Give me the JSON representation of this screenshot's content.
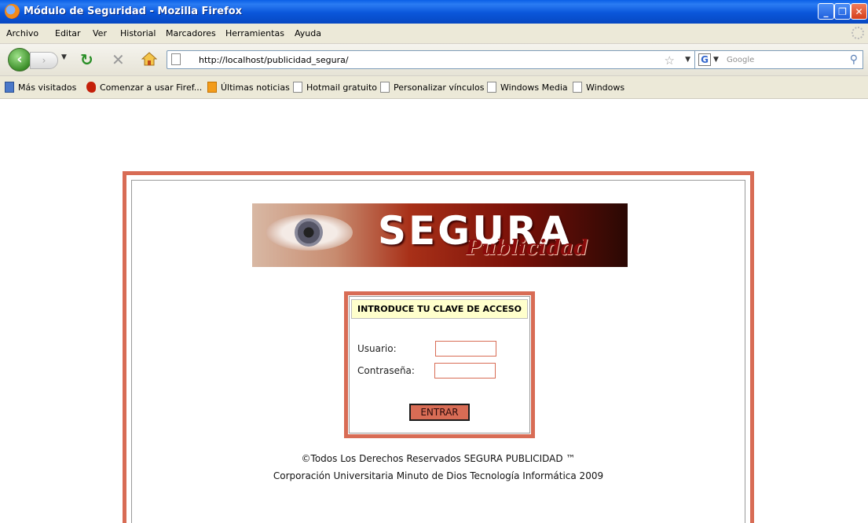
{
  "window": {
    "title": "Módulo de Seguridad - Mozilla Firefox",
    "minimize": "_",
    "restore": "❐",
    "close": "✕"
  },
  "menu": {
    "items": [
      "Archivo",
      "Editar",
      "Ver",
      "Historial",
      "Marcadores",
      "Herramientas",
      "Ayuda"
    ]
  },
  "nav": {
    "url": "http://localhost/publicidad_segura/",
    "search_placeholder": "Google"
  },
  "bookmarks": {
    "items": [
      {
        "label": "Más visitados",
        "icon": "most-visited-icon"
      },
      {
        "label": "Comenzar a usar Firef...",
        "icon": "firefox-icon"
      },
      {
        "label": "Últimas noticias",
        "icon": "rss-icon"
      },
      {
        "label": "Hotmail gratuito",
        "icon": "page-icon"
      },
      {
        "label": "Personalizar vínculos",
        "icon": "page-icon"
      },
      {
        "label": "Windows Media",
        "icon": "page-icon"
      },
      {
        "label": "Windows",
        "icon": "page-icon"
      }
    ]
  },
  "banner": {
    "word": "SEGURA",
    "sub": "Publicidad"
  },
  "login": {
    "heading": "INTRODUCE TU CLAVE DE ACCESO",
    "user_label": "Usuario:",
    "password_label": "Contraseña:",
    "user_value": "",
    "password_value": "",
    "submit_label": "ENTRAR"
  },
  "footer": {
    "line1": "©Todos Los Derechos Reservados SEGURA PUBLICIDAD ™",
    "line2": "Corporación Universitaria Minuto de Dios Tecnología Informática 2009"
  },
  "colors": {
    "frame_accent": "#d86c55",
    "login_header_bg": "#ffffcc"
  }
}
